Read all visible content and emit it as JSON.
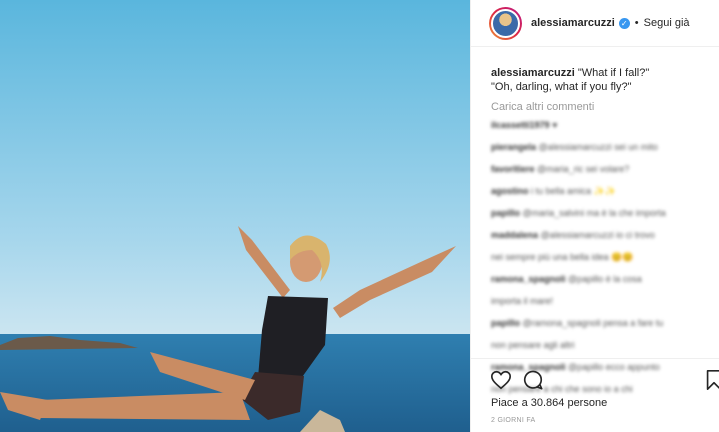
{
  "header": {
    "username": "alessiamarcuzzi",
    "verified_glyph": "✓",
    "separator": "•",
    "follow_label": "Segui già"
  },
  "caption": {
    "username": "alessiamarcuzzi",
    "line1": "\"What if I fall?\"",
    "line2": "\"Oh, darling, what if you fly?\""
  },
  "load_more": "Carica altri commenti",
  "blurred_comments": [
    {
      "user": "ilcassetti1979",
      "text": "♥"
    },
    {
      "user": "pierangela",
      "text": "@alessiamarcuzzi sei un mito"
    },
    {
      "user": "favoritiere",
      "text": "@maria_ric sei volare?"
    },
    {
      "user": "agostino",
      "text": "i tu bella amica ✨✨"
    },
    {
      "user": "papillo",
      "text": "@maria_salvini ma è la che importa"
    },
    {
      "user": "maddalena",
      "text": "@alessiamarcuzzi io ci trovo"
    },
    {
      "user": "",
      "text": "nei sempre più una bella idea 😊😊"
    },
    {
      "user": "ramona_spagnoli",
      "text": "@papillo è la cosa"
    },
    {
      "user": "",
      "text": "importa il mare!"
    },
    {
      "user": "papillo",
      "text": "@ramona_spagnoli pensa a fare tu"
    },
    {
      "user": "",
      "text": "non pensare agli altri"
    },
    {
      "user": "ramona_spagnoli",
      "text": "@papillo ecco appunto"
    },
    {
      "user": "",
      "text": "non pensare a chi che sono io a chi"
    }
  ],
  "likes": "Piace a 30.864 persone",
  "date": "2 GIORNI FA"
}
